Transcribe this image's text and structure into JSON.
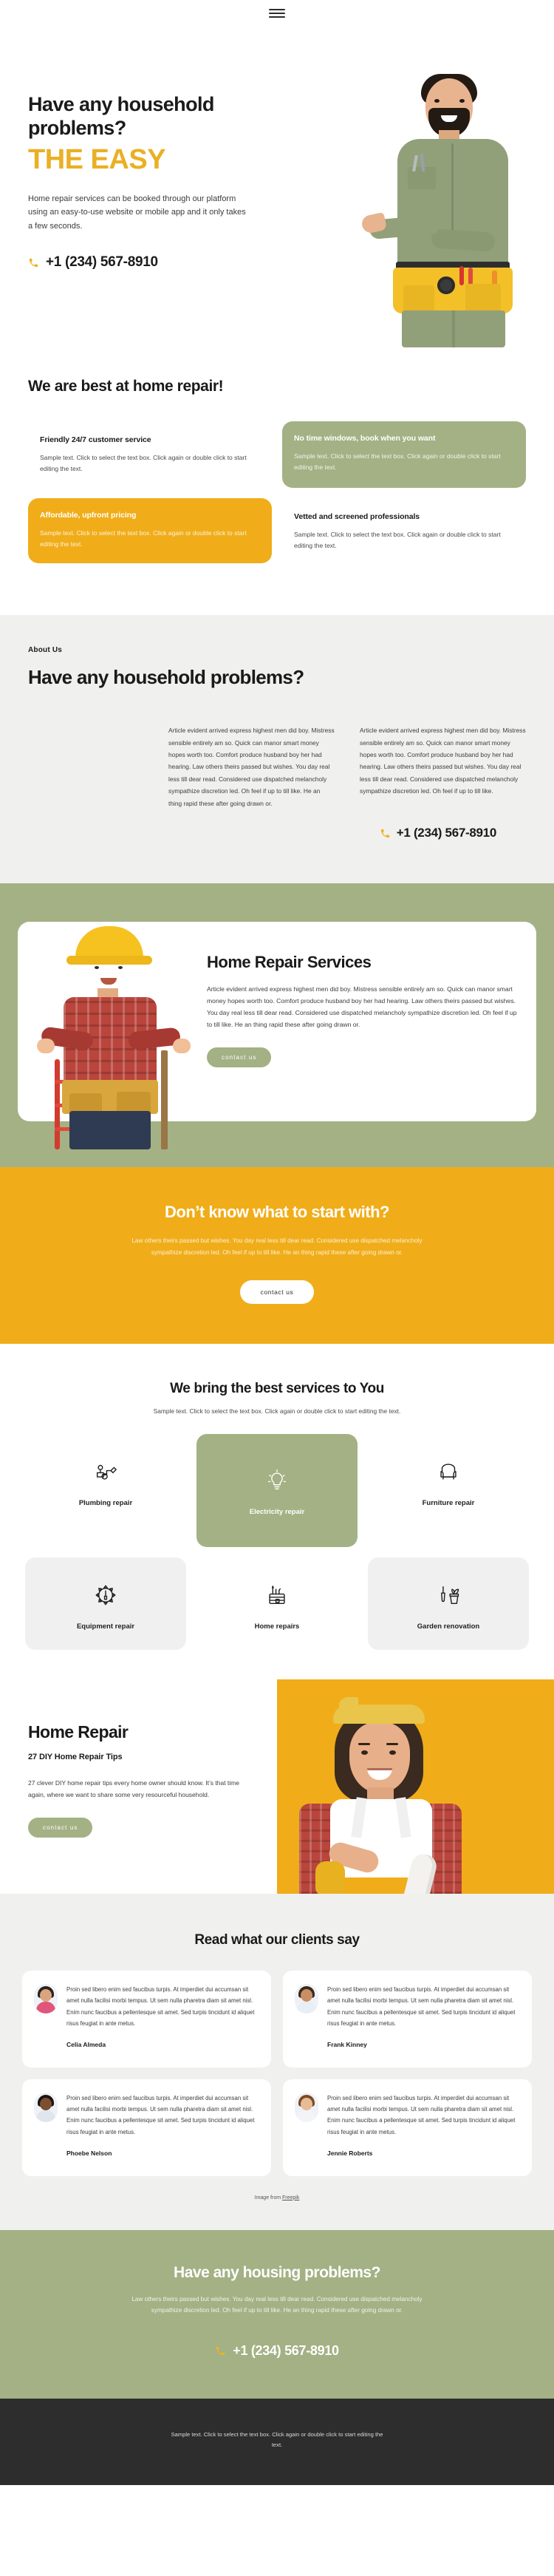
{
  "header": {
    "menu_label": "menu"
  },
  "hero": {
    "title": "Have any household problems?",
    "subtitle": "THE EASY",
    "paragraph": "Home repair services can be booked through our platform using an easy-to-use website or mobile app and it only takes a few seconds.",
    "phone": "+1 (234) 567-8910",
    "phone_icon": "phone-icon"
  },
  "best": {
    "title": "We are best at home repair!",
    "cards": [
      {
        "title": "Friendly 24/7 customer service",
        "text": "Sample text. Click to select the text box. Click again or double click to start editing the text.",
        "style": "plain"
      },
      {
        "title": "No time windows, book when you want",
        "text": "Sample text. Click to select the text box. Click again or double click to start editing the text.",
        "style": "green"
      },
      {
        "title": "Affordable, upfront pricing",
        "text": "Sample text. Click to select the text box. Click again or double click to start editing the text.",
        "style": "yellow"
      },
      {
        "title": "Vetted and screened professionals",
        "text": "Sample text. Click to select the text box. Click again or double click to start editing the text.",
        "style": "plain"
      }
    ]
  },
  "about": {
    "eyebrow": "About Us",
    "title": "Have any household problems?",
    "col1": "Article evident arrived express highest men did boy. Mistress sensible entirely am so. Quick can manor smart money hopes worth too. Comfort produce husband boy her had hearing. Law others theirs passed but wishes. You day real less till dear read. Considered use dispatched melancholy sympathize discretion led. Oh feel if up to till like. He an thing rapid these after going drawn or.",
    "col2": "Article evident arrived express highest men did boy. Mistress sensible entirely am so. Quick can manor smart money hopes worth too. Comfort produce husband boy her had hearing. Law others theirs passed but wishes. You day real less till dear read. Considered use dispatched melancholy sympathize discretion led. Oh feel if up to till like.",
    "phone": "+1 (234) 567-8910"
  },
  "services_panel": {
    "title": "Home Repair Services",
    "paragraph": "Article evident arrived express highest men did boy. Mistress sensible entirely am so. Quick can manor smart money hopes worth too. Comfort produce husband boy her had hearing. Law others theirs passed but wishes. You day real less till dear read. Considered use dispatched melancholy sympathize discretion led. Oh feel if up to till like. He an thing rapid these after going drawn or.",
    "button": "contact us"
  },
  "cta_yellow": {
    "title": "Don’t know what to start with?",
    "paragraph": "Law others theirs passed but wishes. You day real less till dear read. Considered use dispatched melancholy sympathize discretion led. Oh feel if up to till like. He an thing rapid these after going drawn or.",
    "button": "contact us"
  },
  "services_grid": {
    "title": "We bring the best services to You",
    "subtitle": "Sample text. Click to select the text box. Click again or double click to start editing the text.",
    "items": [
      {
        "label": "Plumbing repair",
        "icon": "pipe-wrench-icon",
        "style": "blank"
      },
      {
        "label": "Electricity repair",
        "icon": "lightbulb-icon",
        "style": "green"
      },
      {
        "label": "Furniture repair",
        "icon": "armchair-icon",
        "style": "blank"
      },
      {
        "label": "Equipment repair",
        "icon": "gear-screwdriver-icon",
        "style": "grey"
      },
      {
        "label": "Home repairs",
        "icon": "toolbox-icon",
        "style": "blank"
      },
      {
        "label": "Garden renovation",
        "icon": "plant-trowel-icon",
        "style": "grey"
      }
    ]
  },
  "home_repair": {
    "title": "Home Repair",
    "subtitle": "27 DIY Home Repair Tips",
    "paragraph": "27 clever DIY home repair tips every home owner should know. It’s that time again, where we want to share some very resourceful household.",
    "button": "contact us"
  },
  "testimonials": {
    "title": "Read what our clients say",
    "quote": "Proin sed libero enim sed faucibus turpis. At imperdiet dui accumsan sit amet nulla facilisi morbi tempus. Ut sem nulla pharetra diam sit amet nisl. Enim nunc faucibus a pellentesque sit amet. Sed turpis tincidunt id aliquet risus feugiat in ante metus.",
    "items": [
      {
        "name": "Celia Almeda",
        "skin": "#d9a57f",
        "hair": "#2e2119",
        "shirt": "#e0557a"
      },
      {
        "name": "Frank Kinney",
        "skin": "#c98f63",
        "hair": "#3a2a1c",
        "shirt": "#e8eef5"
      },
      {
        "name": "Phoebe Nelson",
        "skin": "#7a4f32",
        "hair": "#1d1310",
        "shirt": "#dfe6ee"
      },
      {
        "name": "Jennie Roberts",
        "skin": "#e8bb95",
        "hair": "#7b4b26",
        "shirt": "#f2f4f7"
      }
    ],
    "credit_prefix": "Image from ",
    "credit_link": "Freepik"
  },
  "footer_green": {
    "title": "Have any housing problems?",
    "paragraph": "Law others theirs passed but wishes. You day real less till dear read. Considered use dispatched melancholy sympathize discretion led. Oh feel if up to till like. He an thing rapid these after going drawn or.",
    "phone": "+1 (234) 567-8910"
  },
  "footer_dark": {
    "text": "Sample text. Click to select the text box. Click again or double click to start editing the text."
  },
  "colors": {
    "yellow": "#f0ad19",
    "green": "#a3b184",
    "dark": "#2d2d2d",
    "light_grey": "#f0f0ee"
  }
}
